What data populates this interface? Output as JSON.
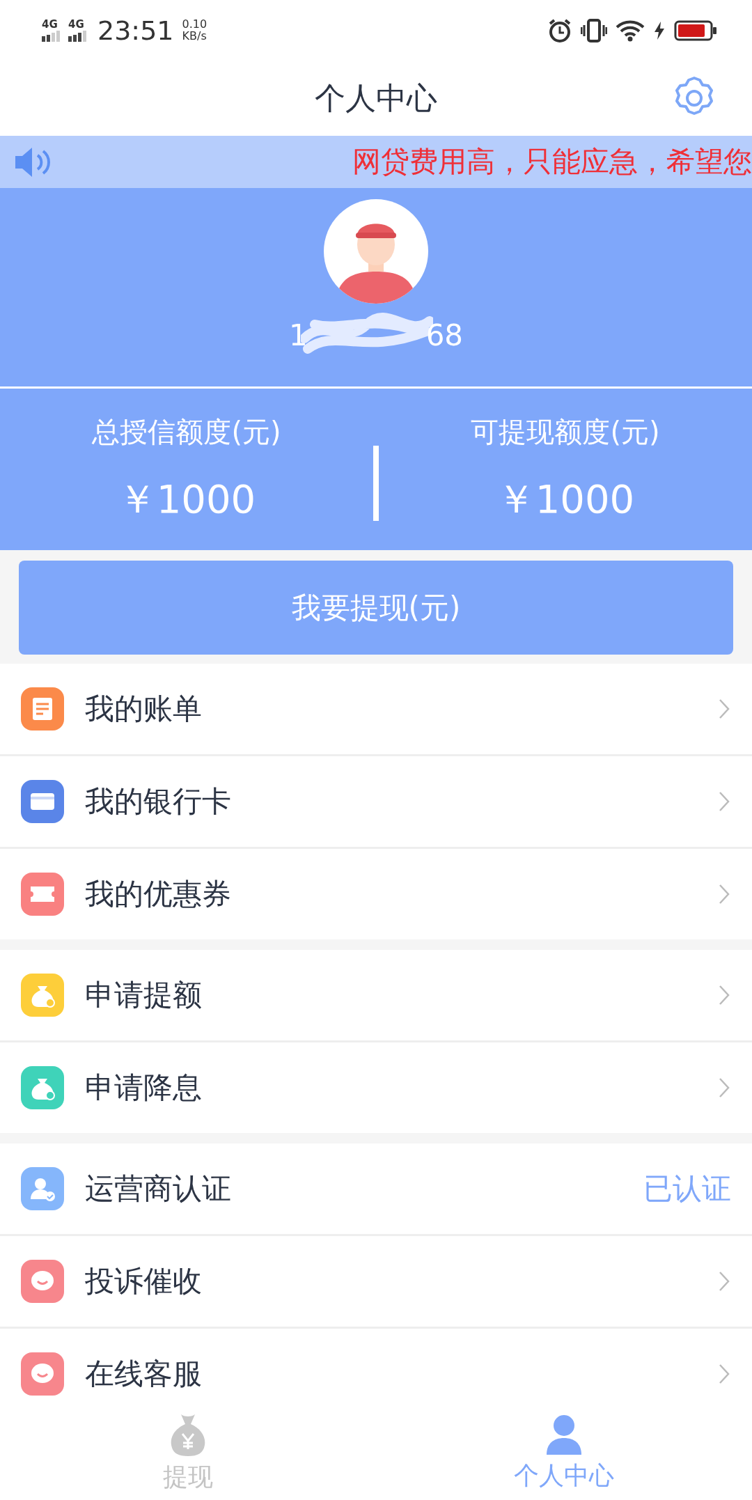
{
  "status_bar": {
    "network_1": "4G",
    "network_2": "4G",
    "time": "23:51",
    "speed_value": "0.10",
    "speed_unit": "KB/s"
  },
  "header": {
    "title": "个人中心"
  },
  "notice": {
    "text": "网贷费用高，只能应急，希望您"
  },
  "profile": {
    "phone_start": "1",
    "phone_end": "68"
  },
  "stats": [
    {
      "label": "总授信额度(元)",
      "value": "￥1000"
    },
    {
      "label": "可提现额度(元)",
      "value": "￥1000"
    }
  ],
  "withdraw_button": "我要提现(元)",
  "menu_sections": [
    {
      "items": [
        {
          "label": "我的账单",
          "kind": "bill",
          "color": "#fb8a4a"
        },
        {
          "label": "我的银行卡",
          "kind": "card",
          "color": "#5a85e8"
        },
        {
          "label": "我的优惠券",
          "kind": "coupon",
          "color": "#f98181"
        }
      ]
    },
    {
      "items": [
        {
          "label": "申请提额",
          "kind": "money",
          "color": "#fdce3a"
        },
        {
          "label": "申请降息",
          "kind": "money",
          "color": "#3fd3b9"
        }
      ]
    },
    {
      "items": [
        {
          "label": "运营商认证",
          "kind": "verify",
          "color": "#85b6fb",
          "status": "已认证"
        },
        {
          "label": "投诉催收",
          "kind": "chat",
          "color": "#f7868c"
        },
        {
          "label": "在线客服",
          "kind": "chat",
          "color": "#f7868c"
        }
      ]
    }
  ],
  "bottom_nav": [
    {
      "label": "提现",
      "kind": "money",
      "selected": false
    },
    {
      "label": "个人中心",
      "kind": "person",
      "selected": true
    }
  ]
}
